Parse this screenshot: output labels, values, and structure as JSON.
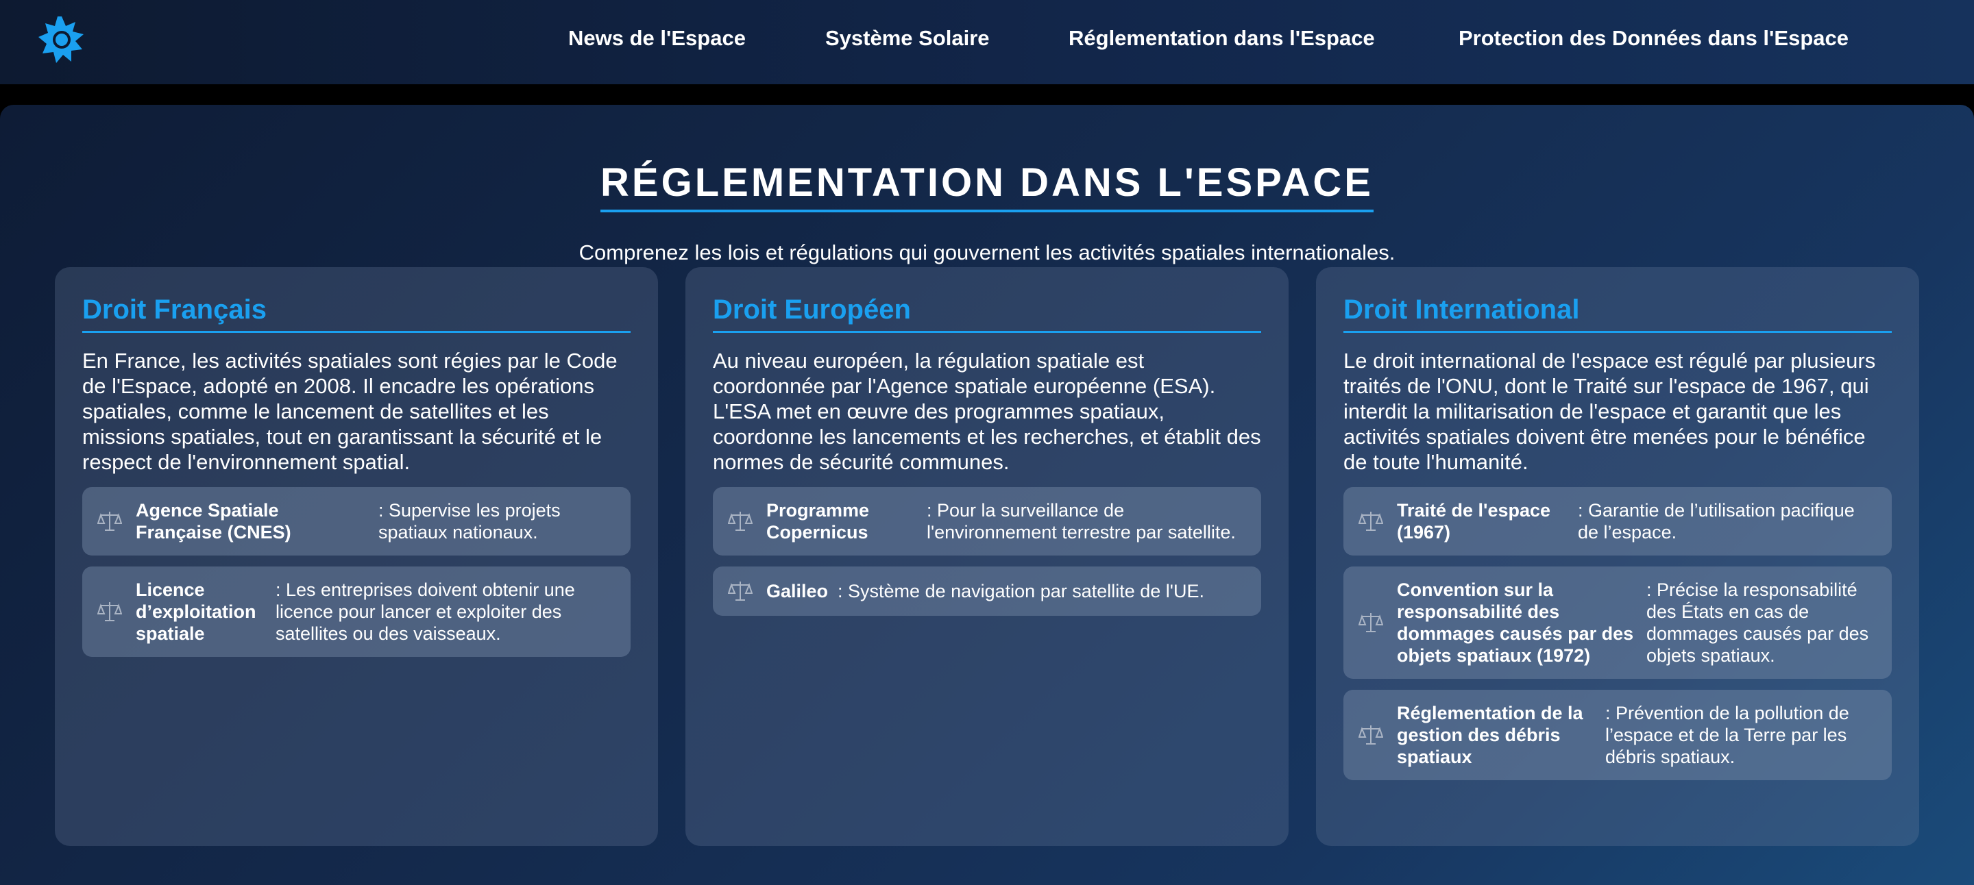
{
  "nav": {
    "items": [
      "News de l'Espace",
      "Système Solaire",
      "Réglementation dans l'Espace",
      "Protection des Données dans l'Espace"
    ]
  },
  "logo_icon": "sun-icon",
  "page": {
    "title": "RÉGLEMENTATION DANS L'ESPACE",
    "subtitle": "Comprenez les lois et régulations qui gouvernent les activités spatiales internationales."
  },
  "cards": [
    {
      "title": "Droit Français",
      "text": "En France, les activités spatiales sont régies par le Code de l'Espace, adopté en 2008. Il encadre les opérations spatiales, comme le lancement de satellites et les missions spatiales, tout en garantissant la sécurité et le respect de l'environnement spatial.",
      "items": [
        {
          "term": "Agence Spatiale Française (CNES)",
          "desc": ": Supervise les projets spatiaux nationaux."
        },
        {
          "term": "Licence d’exploitation spatiale",
          "desc": ": Les entreprises doivent obtenir une licence pour lancer et exploiter des satellites ou des vaisseaux."
        }
      ]
    },
    {
      "title": "Droit Européen",
      "text": "Au niveau européen, la régulation spatiale est coordonnée par l'Agence spatiale européenne (ESA). L'ESA met en œuvre des programmes spatiaux, coordonne les lancements et les recherches, et établit des normes de sécurité communes.",
      "items": [
        {
          "term": "Programme Copernicus",
          "desc": ": Pour la surveillance de l'environnement terrestre par satellite."
        },
        {
          "term": "Galileo",
          "desc": ": Système de navigation par satellite de l'UE."
        }
      ]
    },
    {
      "title": "Droit International",
      "text": "Le droit international de l'espace est régulé par plusieurs traités de l'ONU, dont le Traité sur l'espace de 1967, qui interdit la militarisation de l'espace et garantit que les activités spatiales doivent être menées pour le bénéfice de toute l'humanité.",
      "items": [
        {
          "term": "Traité de l'espace (1967)",
          "desc": ": Garantie de l’utilisation pacifique de l’espace."
        },
        {
          "term": "Convention sur la responsabilité des dommages causés par des objets spatiaux (1972)",
          "desc": ": Précise la responsabilité des États en cas de dommages causés par des objets spatiaux."
        },
        {
          "term": "Réglementation de la gestion des débris spatiaux",
          "desc": ": Prévention de la pollution de l’espace et de la Terre par les débris spatiaux."
        }
      ]
    }
  ],
  "item_icon": "scales-icon",
  "colors": {
    "accent": "#1aa0f0"
  }
}
